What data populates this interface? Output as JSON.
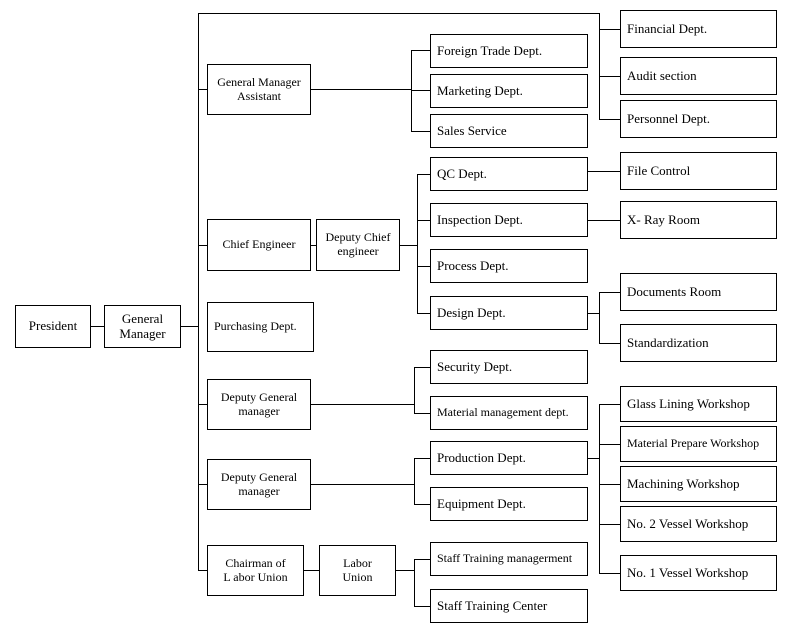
{
  "chart_data": {
    "type": "diagram",
    "title": "Company Organizational Chart",
    "orientation": "left-to-right hierarchy",
    "levels": 4
  },
  "nodes": {
    "president": {
      "label": "President"
    },
    "general_manager": {
      "label": "General\nManager"
    },
    "general_manager_assistant": {
      "label": "General Manager\n Assistant"
    },
    "chief_engineer": {
      "label": "Chief Engineer"
    },
    "deputy_chief_engineer": {
      "label": "Deputy Chief\nengineer"
    },
    "purchasing_dept": {
      "label": "Purchasing Dept."
    },
    "deputy_general_manager_1": {
      "label": "Deputy General\nmanager"
    },
    "deputy_general_manager_2": {
      "label": "Deputy General\nmanager"
    },
    "chairman_labor_union": {
      "label": "Chairman of\nL abor Union"
    },
    "labor_union": {
      "label": "Labor\nUnion"
    },
    "foreign_trade_dept": {
      "label": "Foreign Trade Dept."
    },
    "marketing_dept": {
      "label": "Marketing Dept."
    },
    "sales_service": {
      "label": "Sales Service"
    },
    "qc_dept": {
      "label": "QC Dept."
    },
    "inspection_dept": {
      "label": "Inspection Dept."
    },
    "process_dept": {
      "label": "Process Dept."
    },
    "design_dept": {
      "label": "Design Dept."
    },
    "security_dept": {
      "label": "Security Dept."
    },
    "material_management_dept": {
      "label": "Material management dept."
    },
    "production_dept": {
      "label": "Production Dept."
    },
    "equipment_dept": {
      "label": "Equipment Dept."
    },
    "staff_training_management": {
      "label": "Staff Training managerment"
    },
    "staff_training_center": {
      "label": "Staff Training Center"
    },
    "financial_dept": {
      "label": "Financial Dept."
    },
    "audit_section": {
      "label": "Audit section"
    },
    "personnel_dept": {
      "label": "Personnel Dept."
    },
    "file_control": {
      "label": "File Control"
    },
    "x_ray_room": {
      "label": "X- Ray Room"
    },
    "documents_room": {
      "label": "Documents Room"
    },
    "standardization": {
      "label": "Standardization"
    },
    "glass_lining_workshop": {
      "label": "Glass Lining Workshop"
    },
    "material_prepare_workshop": {
      "label": "Material Prepare Workshop"
    },
    "machining_workshop": {
      "label": "Machining Workshop"
    },
    "no2_vessel_workshop": {
      "label": "No. 2 Vessel Workshop"
    },
    "no1_vessel_workshop": {
      "label": "No. 1 Vessel Workshop"
    }
  },
  "colors": {
    "background": "#ffffff",
    "box_border": "#000000",
    "connector": "#000000",
    "text": "#000000"
  }
}
